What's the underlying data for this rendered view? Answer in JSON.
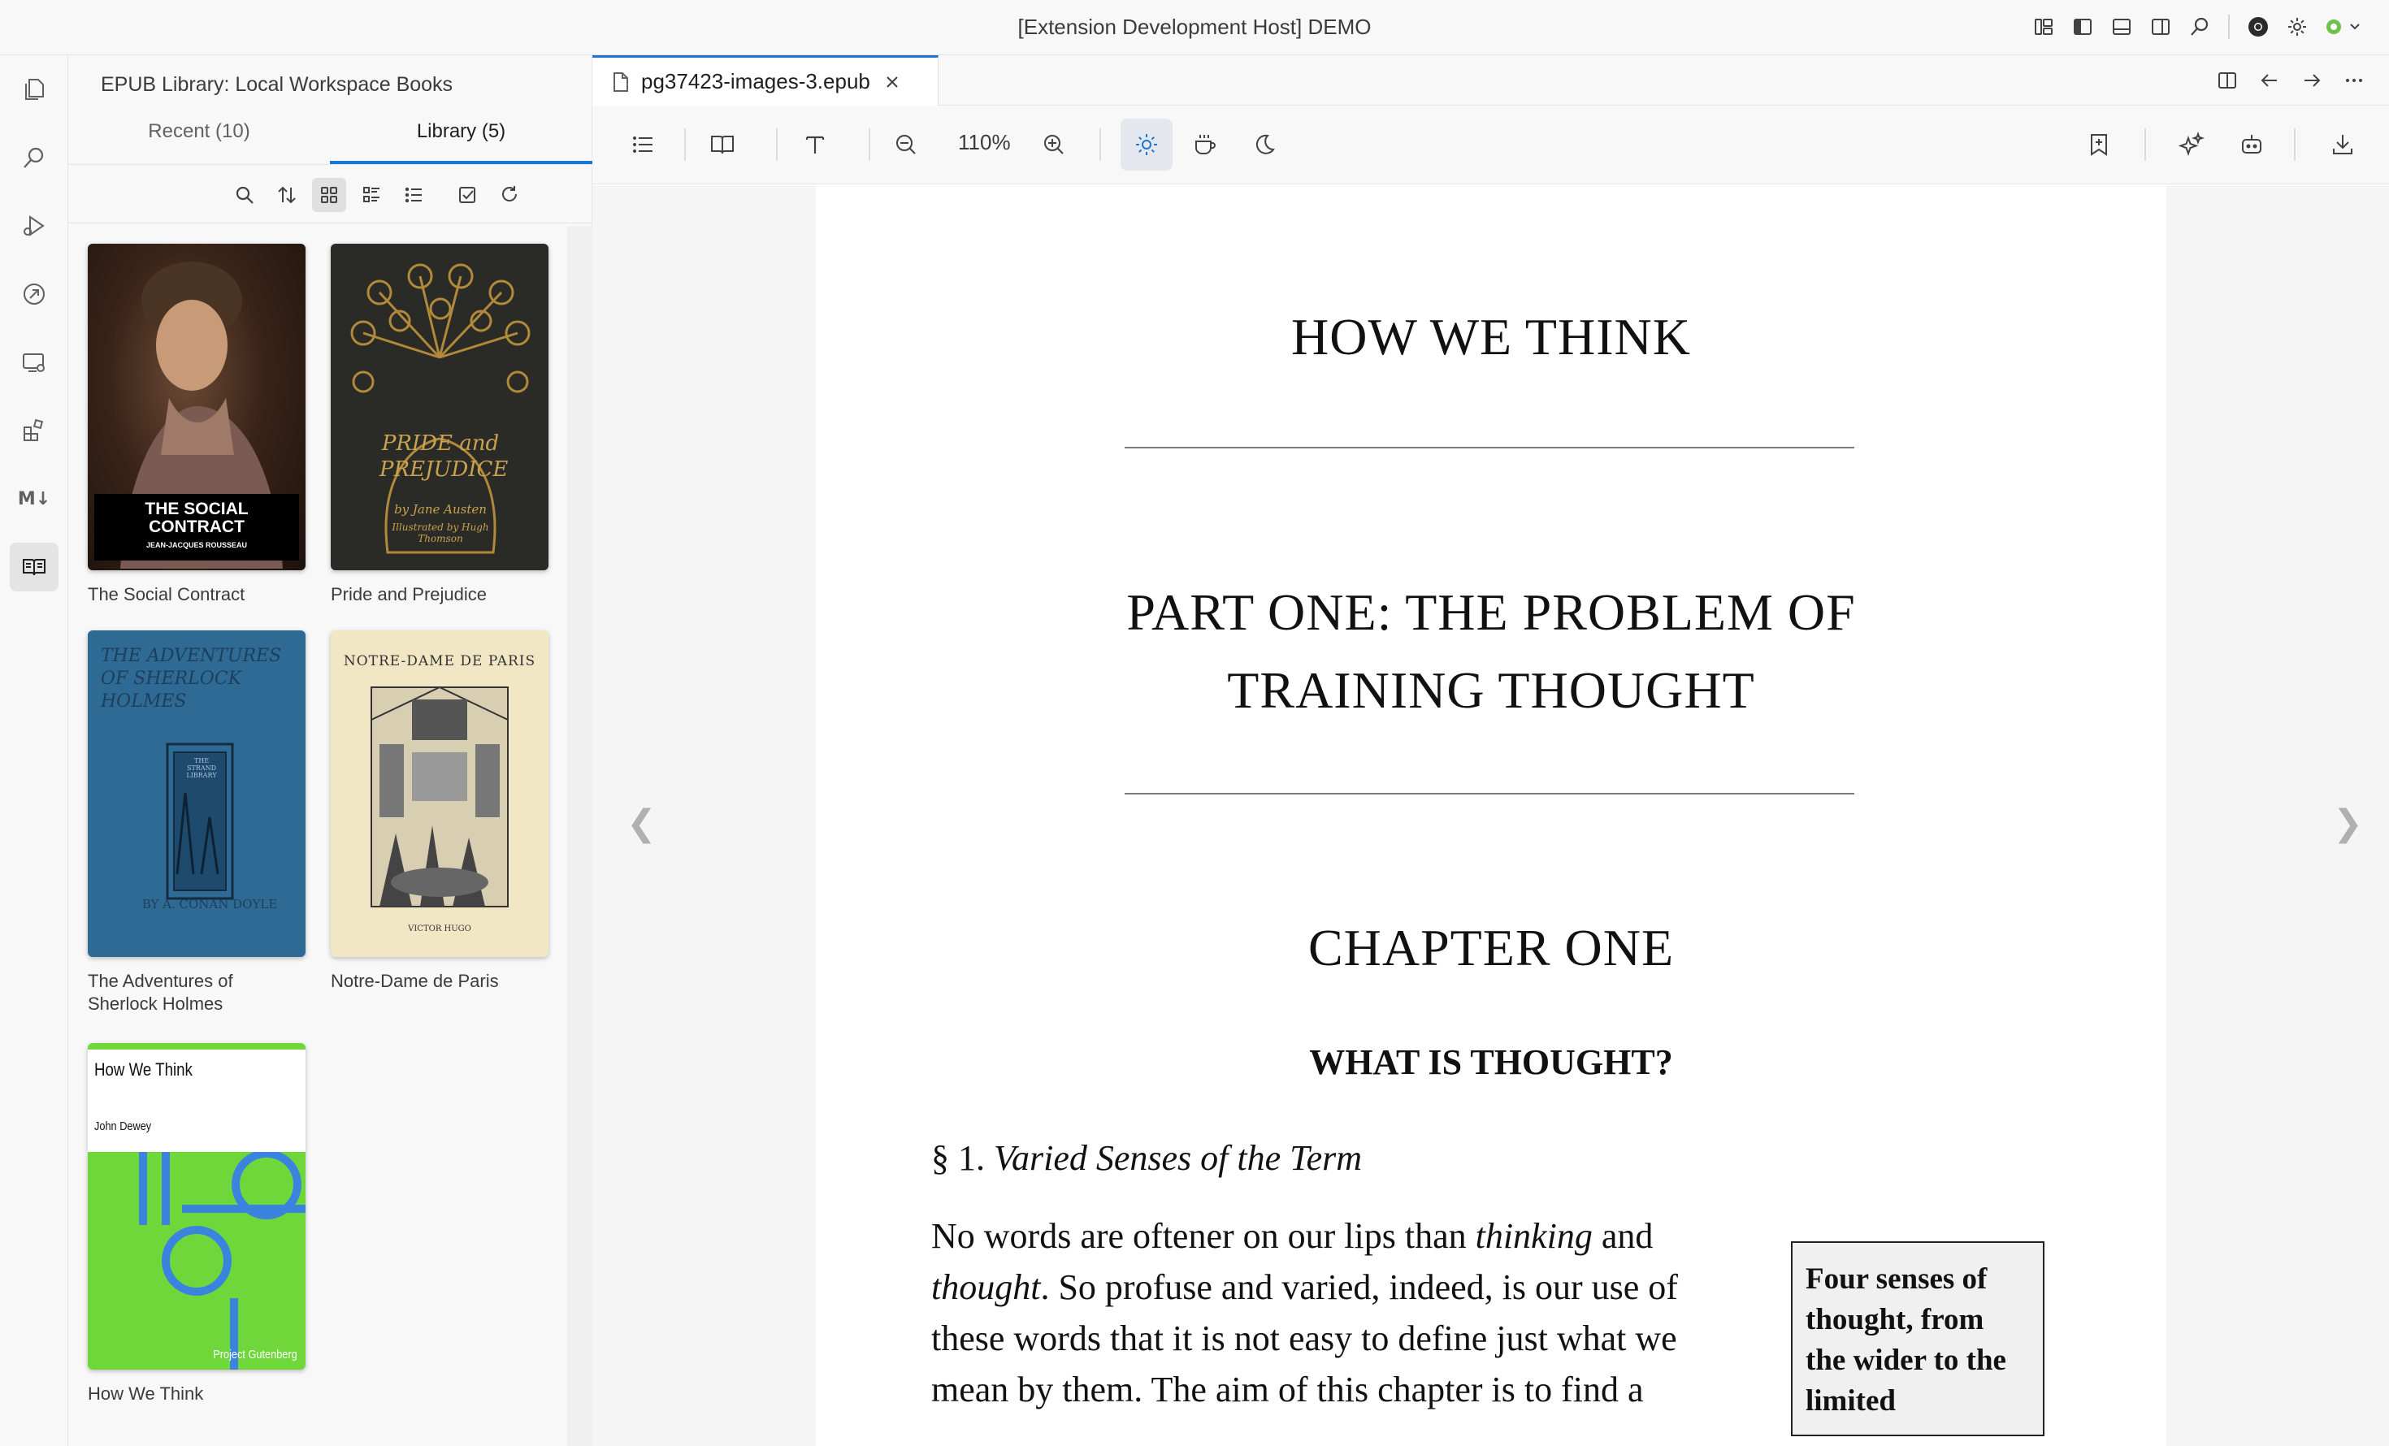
{
  "window": {
    "title": "[Extension Development Host] DEMO"
  },
  "activity_bar": {
    "items": [
      "explorer",
      "search",
      "run-and-debug",
      "remote-explorer",
      "remote-desktop",
      "extensions",
      "markdown",
      "epub-library"
    ],
    "markdown_label": "M↓"
  },
  "sidebar": {
    "title": "EPUB Library: Local Workspace Books",
    "tabs": [
      {
        "label": "Recent (10)",
        "active": false
      },
      {
        "label": "Library (5)",
        "active": true
      }
    ],
    "tools": [
      "search",
      "sort",
      "grid-view",
      "detail-view",
      "list-view",
      "select",
      "refresh"
    ],
    "books": [
      {
        "title": "The Social Contract",
        "cover_text": "THE SOCIAL CONTRACT",
        "cover_author": "JEAN-JACQUES ROUSSEAU"
      },
      {
        "title": "Pride and Prejudice",
        "cover_text": "PRIDE and PREJUDICE",
        "cover_sub": "by Jane Austen",
        "cover_sub2": "Illustrated by Hugh Thomson"
      },
      {
        "title": "The Adventures of Sherlock Holmes",
        "cover_text": "THE ADVENTURES OF SHERLOCK HOLMES",
        "cover_author": "BY A. CONAN DOYLE",
        "cover_badge": "THE STRAND LIBRARY"
      },
      {
        "title": "Notre-Dame de Paris",
        "cover_text": "NOTRE-DAME DE PARIS",
        "cover_author": "VICTOR HUGO"
      },
      {
        "title": "How We Think",
        "cover_text": "How We Think",
        "cover_author": "John Dewey",
        "cover_publisher": "Project Gutenberg"
      }
    ]
  },
  "editor": {
    "tab": {
      "filename": "pg37423-images-3.epub"
    },
    "toolbar": {
      "zoom": "110%",
      "theme_active": "light"
    }
  },
  "content": {
    "book_title": "HOW WE THINK",
    "part_line1": "PART ONE: THE PROBLEM OF",
    "part_line2": "TRAINING THOUGHT",
    "chapter": "CHAPTER ONE",
    "chapter_subtitle": "WHAT IS THOUGHT?",
    "section_number": "§ 1.",
    "section_title": "Varied Senses of the Term",
    "para_1a": "No words are oftener on our lips than ",
    "para_1b": "thinking",
    "para_1c": " and ",
    "para_2a": "thought",
    "para_2b": ". So profuse and varied, indeed, is our use of",
    "para_3": "these words that it is not easy to define just what we",
    "para_4": "mean by them. The aim of this chapter is to find a",
    "sidenote": "Four senses of thought, from the wider to the limited",
    "prev_arrow": "❮",
    "next_arrow": "❯"
  },
  "colors": {
    "accent": "#1976d2",
    "how_we_think_green": "#6fd73a",
    "how_we_think_blue": "#3a84e0"
  }
}
